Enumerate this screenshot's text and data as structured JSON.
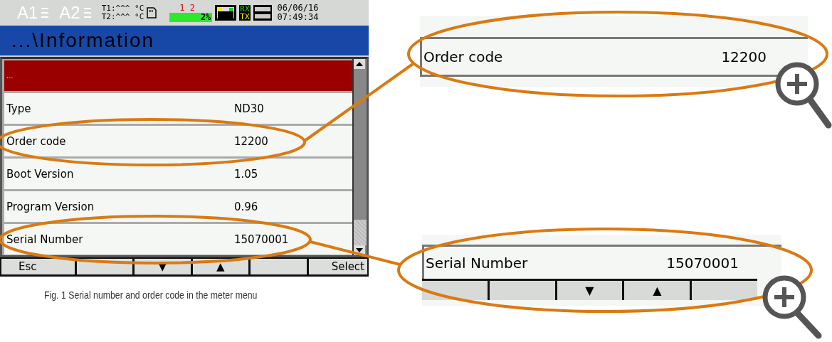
{
  "status_bar": {
    "alarms": [
      "A1",
      "A2"
    ],
    "temps": [
      "T1:^^^ °C",
      "T2:^^^ °C"
    ],
    "channels": "1 2",
    "memory": "2%",
    "rx": "RX",
    "tx": "TX",
    "date": "06/06/16",
    "time": "07:49:34"
  },
  "title": "...\\Information",
  "rows": [
    {
      "label": "...",
      "selected": true
    },
    {
      "label": "Type",
      "value": "ND30",
      "selected": false
    },
    {
      "label": "Order code",
      "value": "12200",
      "selected": false
    },
    {
      "label": "Boot Version",
      "value": "1.05",
      "selected": false
    },
    {
      "label": "Program Version",
      "value": "0.96",
      "selected": false
    },
    {
      "label": "Serial Number",
      "value": "15070001",
      "selected": false
    }
  ],
  "softkeys": [
    {
      "kind": "label",
      "label": "Esc"
    },
    {
      "kind": "blank"
    },
    {
      "kind": "label",
      "label": "▼"
    },
    {
      "kind": "label",
      "label": "▲"
    },
    {
      "kind": "blank"
    },
    {
      "kind": "label",
      "label": "Select"
    }
  ],
  "caption": "Fig. 1 Serial number and order code in the meter menu",
  "callouts": [
    {
      "rows": [
        {
          "label": "Order code",
          "value": "12200"
        }
      ]
    },
    {
      "rows": [
        {
          "label": "Serial Number",
          "value": "15070001"
        }
      ],
      "softkeys": [
        {
          "kind": "blank"
        },
        {
          "kind": "blank"
        },
        {
          "kind": "label",
          "label": "▼"
        },
        {
          "kind": "label",
          "label": "▲"
        },
        {
          "kind": "blank"
        }
      ]
    }
  ]
}
